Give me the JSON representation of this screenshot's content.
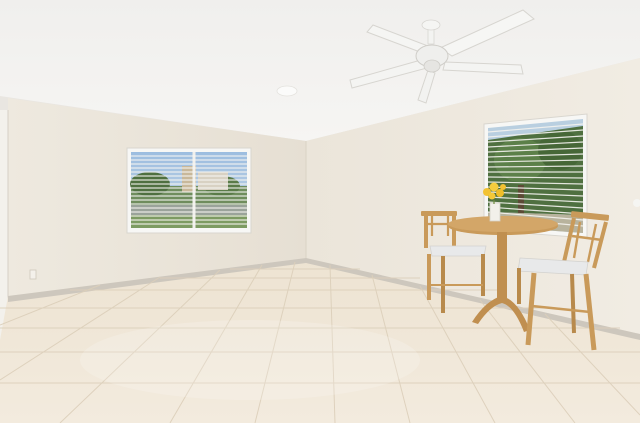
{
  "scene": {
    "subject": "empty-room-with-dining-set",
    "colors": {
      "ceiling": "#f2f1ef",
      "wall": "#ece6dc",
      "wall_shadow": "#e2dbcf",
      "floor": "#eee4d4",
      "grout": "#d9cdb9",
      "baseboard": "#cfcac2",
      "wood": "#c99a5a",
      "wood_dark": "#a97a3e",
      "seat": "#e8e9ea",
      "flowers": "#f2c232",
      "sky": "#8fb3d8",
      "foliage": "#4f7040",
      "fan": "#f4f4f3"
    },
    "icons": [
      "ceiling-fan-icon",
      "window-icon",
      "chair-icon",
      "table-icon",
      "flower-vase-icon",
      "power-outlet-icon"
    ]
  }
}
